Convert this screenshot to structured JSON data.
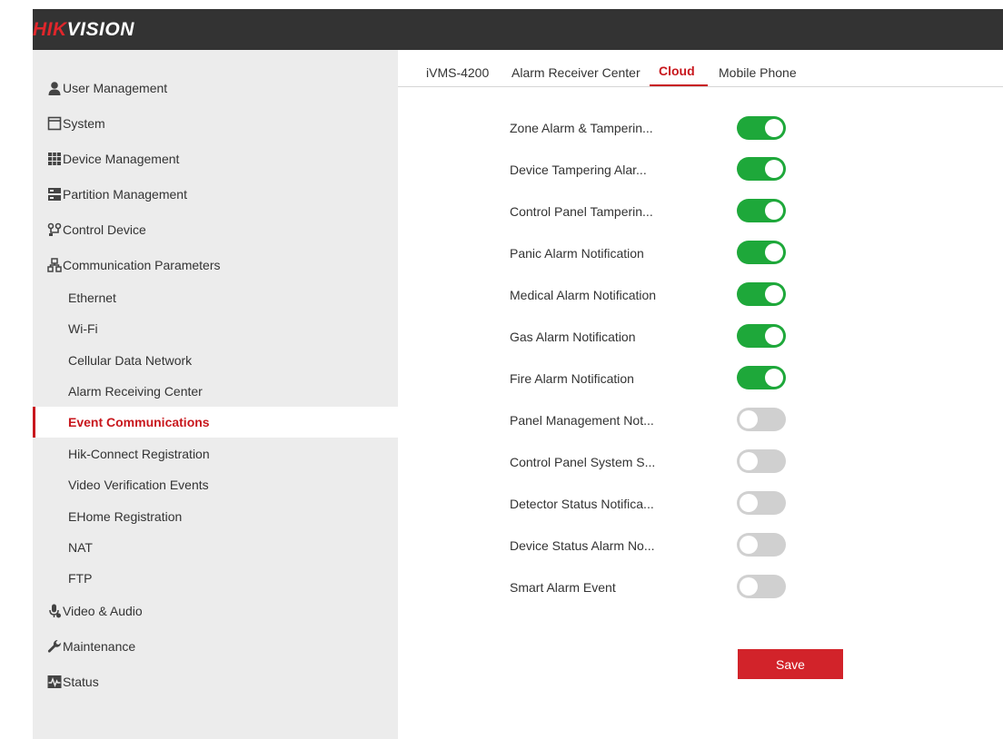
{
  "brand": {
    "logo_red": "HIK",
    "logo_white": "VISION"
  },
  "sidebar": {
    "items": [
      {
        "label": "User Management",
        "icon": "user-icon"
      },
      {
        "label": "System",
        "icon": "window-icon"
      },
      {
        "label": "Device Management",
        "icon": "device-grid-icon"
      },
      {
        "label": "Partition Management",
        "icon": "partition-icon"
      },
      {
        "label": "Control Device",
        "icon": "control-device-icon"
      },
      {
        "label": "Communication Parameters",
        "icon": "network-icon"
      },
      {
        "label": "Ethernet"
      },
      {
        "label": "Wi-Fi"
      },
      {
        "label": "Cellular Data Network"
      },
      {
        "label": "Alarm Receiving Center"
      },
      {
        "label": "Event Communications",
        "active": true
      },
      {
        "label": "Hik-Connect Registration"
      },
      {
        "label": "Video Verification Events"
      },
      {
        "label": "EHome Registration"
      },
      {
        "label": "NAT"
      },
      {
        "label": "FTP"
      },
      {
        "label": "Video & Audio",
        "icon": "microphone-icon"
      },
      {
        "label": "Maintenance",
        "icon": "wrench-icon"
      },
      {
        "label": "Status",
        "icon": "pulse-icon"
      }
    ]
  },
  "tabs": [
    {
      "label": "iVMS-4200"
    },
    {
      "label": "Alarm Receiver Center"
    },
    {
      "label": "Cloud",
      "active": true
    },
    {
      "label": "Mobile Phone"
    }
  ],
  "settings": [
    {
      "label": "Zone Alarm & Tamperin...",
      "enabled": true
    },
    {
      "label": "Device Tampering Alar...",
      "enabled": true
    },
    {
      "label": "Control Panel Tamperin...",
      "enabled": true
    },
    {
      "label": "Panic Alarm Notification",
      "enabled": true
    },
    {
      "label": "Medical Alarm Notification",
      "enabled": true
    },
    {
      "label": "Gas Alarm Notification",
      "enabled": true
    },
    {
      "label": "Fire Alarm Notification",
      "enabled": true
    },
    {
      "label": "Panel Management Not...",
      "enabled": false
    },
    {
      "label": "Control Panel System S...",
      "enabled": false
    },
    {
      "label": "Detector Status Notifica...",
      "enabled": false
    },
    {
      "label": "Device Status Alarm No...",
      "enabled": false
    },
    {
      "label": "Smart Alarm Event",
      "enabled": false
    }
  ],
  "save_label": "Save",
  "colors": {
    "accent": "#c8171d",
    "toggle_on": "#1ea83a",
    "toggle_off": "#d0d0d0",
    "topbar": "#333333",
    "sidebar_bg": "#ececec"
  }
}
